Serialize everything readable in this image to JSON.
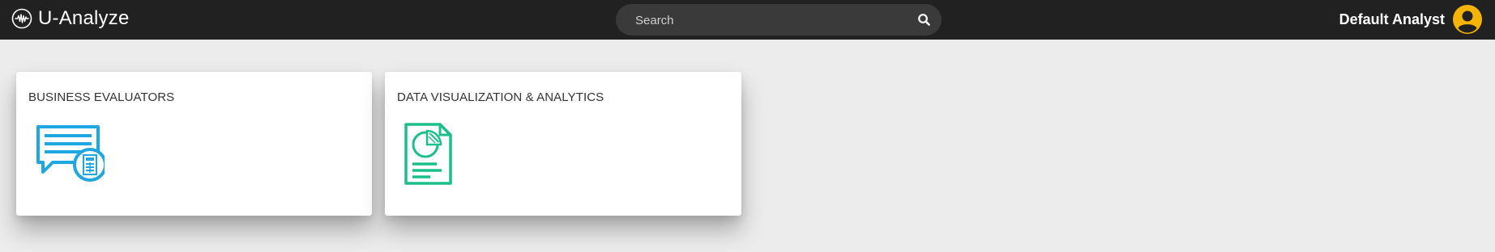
{
  "header": {
    "app_name": "U-Analyze",
    "logo_icon": "waveform-circle-icon",
    "search": {
      "placeholder": "Search",
      "value": "",
      "icon": "search-icon"
    },
    "user": {
      "name": "Default Analyst",
      "avatar_icon": "user-avatar-icon",
      "avatar_color": "#f5b400"
    },
    "background_color": "#212121"
  },
  "cards": [
    {
      "title": "BUSINESS EVALUATORS",
      "icon": "chat-calculator-icon",
      "icon_color": "#1ea7e1"
    },
    {
      "title": "DATA VISUALIZATION & ANALYTICS",
      "icon": "pie-chart-document-icon",
      "icon_color": "#1bbf8a"
    }
  ],
  "page_background": "#ececec"
}
